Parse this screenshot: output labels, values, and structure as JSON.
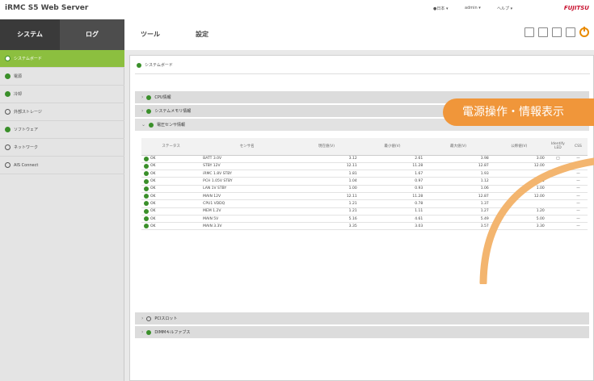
{
  "app": {
    "title": "iRMC S5 Web Server",
    "top_right": [
      "●日本 ▾",
      "admin ▾",
      "ヘルプ ▾"
    ],
    "brand": "FUJITSU"
  },
  "nav": {
    "tabs": [
      "システム",
      "ログ",
      "ツール",
      "設定"
    ],
    "toolbar_icons": [
      "monitor-icon",
      "list-icon",
      "grid-icon",
      "printer-icon",
      "power-icon"
    ]
  },
  "sidebar": {
    "items": [
      {
        "label": "システムボード",
        "icon": "dot-white"
      },
      {
        "label": "電源",
        "icon": "dot-green"
      },
      {
        "label": "冷却",
        "icon": "dot-green"
      },
      {
        "label": "外部ストレージ",
        "icon": "dot-hollow"
      },
      {
        "label": "ソフトウェア",
        "icon": "dot-green"
      },
      {
        "label": "ネットワーク",
        "icon": "dot-hollow"
      },
      {
        "label": "AIS Connect",
        "icon": "dot-hollow"
      }
    ]
  },
  "main": {
    "breadcrumb": "システムボード",
    "sections": [
      {
        "label": "CPU情報"
      },
      {
        "label": "システムメモリ情報"
      },
      {
        "label": "電圧センサ情報"
      }
    ],
    "table": {
      "headers": [
        "ステータス",
        "センサ名",
        "現在値(V)",
        "最小値(V)",
        "最大値(V)",
        "公称値(V)",
        "Identify LED",
        "CSS"
      ],
      "rows": [
        [
          "OK",
          "BATT 3.0V",
          "3.12",
          "2.61",
          "3.98",
          "3.00",
          "□",
          "—"
        ],
        [
          "OK",
          "STBY 12V",
          "12.11",
          "11.28",
          "12.87",
          "12.00",
          "",
          "—"
        ],
        [
          "OK",
          "iRMC 1.8V STBY",
          "1.81",
          "1.67",
          "1.93",
          "",
          "",
          "—"
        ],
        [
          "OK",
          "PCH 1.05V STBY",
          "1.04",
          "0.97",
          "1.12",
          "1.05",
          "",
          "—"
        ],
        [
          "OK",
          "LAN 1V STBY",
          "1.00",
          "0.93",
          "1.06",
          "1.00",
          "",
          "—"
        ],
        [
          "OK",
          "MAIN 12V",
          "12.11",
          "11.28",
          "12.87",
          "12.00",
          "",
          "—"
        ],
        [
          "OK",
          "CPU1 VDDQ",
          "1.21",
          "0.78",
          "1.37",
          "",
          "",
          "—"
        ],
        [
          "OK",
          "MEM 1.2V",
          "1.21",
          "1.11",
          "1.27",
          "1.20",
          "",
          "—"
        ],
        [
          "OK",
          "MAIN 5V",
          "5.16",
          "4.61",
          "5.49",
          "5.00",
          "",
          "—"
        ],
        [
          "OK",
          "MAIN 3.3V",
          "3.35",
          "3.03",
          "3.57",
          "3.30",
          "",
          "—"
        ]
      ]
    },
    "lower_sections": [
      {
        "label": "PCIスロット"
      },
      {
        "label": "DIMMキルファブス"
      }
    ]
  },
  "banner": {
    "text": "電源操作・情報表示"
  },
  "colors": {
    "accent_green": "#8cbf3f",
    "status_green": "#3a8f2a",
    "banner_orange": "#f0963a",
    "nav_dark": "#3a3a3a"
  }
}
